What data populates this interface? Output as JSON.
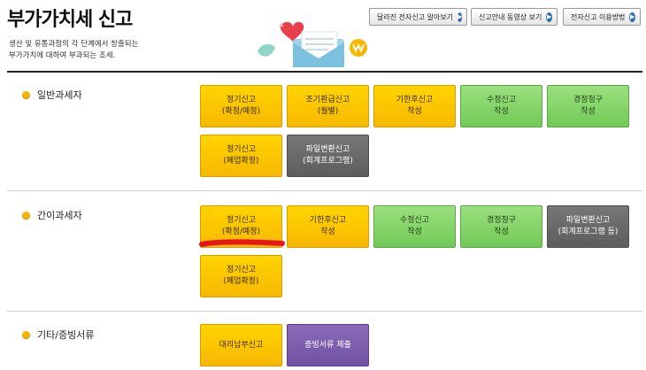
{
  "header": {
    "title": "부가가치세 신고",
    "description": "생산 및 유통과정의 각 단계에서 창출되는\n부가가치에 대하여 부과되는 조세."
  },
  "top_buttons": [
    {
      "label": "달라진 전자신고 알아보기"
    },
    {
      "label": "신고안내 동영상 보기"
    },
    {
      "label": "전자신고 이용방법"
    }
  ],
  "sections": [
    {
      "label": "일반과세자",
      "tiles": [
        {
          "line1": "정기신고",
          "line2": "(확정/예정)",
          "color": "yellow"
        },
        {
          "line1": "조기환급신고",
          "line2": "(월별)",
          "color": "yellow"
        },
        {
          "line1": "기한후신고",
          "line2": "작성",
          "color": "yellow"
        },
        {
          "line1": "수정신고",
          "line2": "작성",
          "color": "green"
        },
        {
          "line1": "경정청구",
          "line2": "작성",
          "color": "green"
        },
        {
          "line1": "정기신고",
          "line2": "(폐업확정)",
          "color": "yellow"
        },
        {
          "line1": "파일변환신고",
          "line2": "(회계프로그램)",
          "color": "gray"
        }
      ]
    },
    {
      "label": "간이과세자",
      "tiles": [
        {
          "line1": "정기신고",
          "line2": "(확정/예정)",
          "color": "yellow"
        },
        {
          "line1": "기한후신고",
          "line2": "작성",
          "color": "yellow"
        },
        {
          "line1": "수정신고",
          "line2": "작성",
          "color": "green"
        },
        {
          "line1": "경정청구",
          "line2": "작성",
          "color": "green"
        },
        {
          "line1": "파일변환신고",
          "line2": "(회계프로그램 등)",
          "color": "gray"
        },
        {
          "line1": "정기신고",
          "line2": "(폐업확정)",
          "color": "yellow"
        }
      ]
    },
    {
      "label": "기타/증빙서류",
      "tiles": [
        {
          "line1": "대리납부신고",
          "line2": "",
          "color": "yellow"
        },
        {
          "line1": "증빙서류 제출",
          "line2": "",
          "color": "purple"
        }
      ]
    }
  ],
  "colors": {
    "yellow": "#f7c400",
    "green": "#7dd062",
    "gray": "#666666",
    "purple": "#7a5aab",
    "annotation_red": "#e8141c"
  }
}
